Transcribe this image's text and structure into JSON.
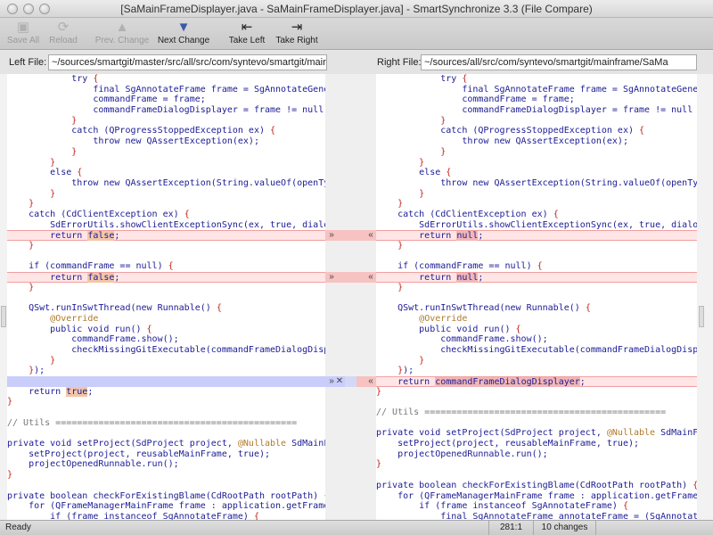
{
  "window": {
    "title": "[SaMainFrameDisplayer.java - SaMainFrameDisplayer.java] - SmartSynchronize 3.3 (File Compare)"
  },
  "toolbar": {
    "save_all": "Save All",
    "reload": "Reload",
    "prev_change": "Prev. Change",
    "next_change": "Next Change",
    "take_left": "Take Left",
    "take_right": "Take Right"
  },
  "files": {
    "left_label": "Left File:",
    "left_path": "~/sources/smartgit/master/src/all/src/com/syntevo/smartgit/mair",
    "right_label": "Right File:",
    "right_path": "~/sources/all/src/com/syntevo/smartgit/mainframe/SaMa"
  },
  "gutter": {
    "take_right_glyph": "»",
    "take_left_glyph": "«",
    "discard_glyph": "✕"
  },
  "status": {
    "text": "Ready",
    "position": "281:1",
    "changes": "10 changes"
  },
  "colors": {
    "change_bg": "#ffe5e5",
    "change_border": "#f0a0a0",
    "highlight": "#f3c6a7",
    "blue_block": "#c9cdfa",
    "keyword": "#1b1b95",
    "brace": "#c0241c"
  }
}
